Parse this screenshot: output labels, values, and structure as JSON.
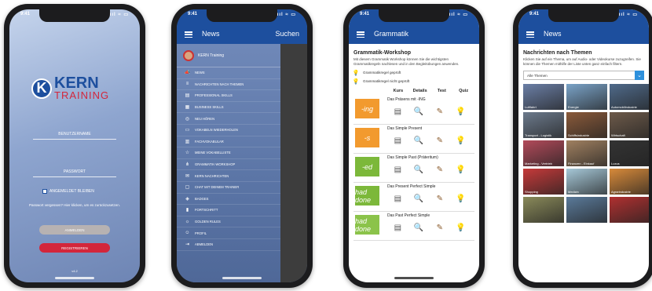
{
  "status_time": "9:41",
  "status_signal": "ııl ≈ ▭",
  "login": {
    "logo_letter": "K",
    "logo_kern": "KERN",
    "logo_training": "TRAINING",
    "username_placeholder": "BENUTZERNAME",
    "password_placeholder": "PASSWORT",
    "remember_label": "ANGEMELDET BLEIBEN",
    "forgot_text": "Passwort vergessen? Hier klicken, um es zurückzusetzen.",
    "login_button": "ANMELDEN",
    "register_button": "REGISTRIEREN",
    "footer": "v4.2"
  },
  "news_menu": {
    "title": "News",
    "search_label": "Suchen",
    "user_name": "KERN Training",
    "items": [
      {
        "label": "NEWS",
        "icon": "megaphone-icon",
        "glyph": "📣"
      },
      {
        "label": "NACHRICHTEN NACH THEMEN",
        "icon": "list-icon",
        "glyph": "≡"
      },
      {
        "label": "PROFESSIONAL SKILLS",
        "icon": "briefcase-icon",
        "glyph": "▤"
      },
      {
        "label": "BUSINESS SKILLS",
        "icon": "chart-icon",
        "glyph": "▦"
      },
      {
        "label": "NEU HÖREN",
        "icon": "headphones-icon",
        "glyph": "◎"
      },
      {
        "label": "VOKABELN WIEDERHOLEN",
        "icon": "cards-icon",
        "glyph": "▭"
      },
      {
        "label": "FACHVOKABULAR",
        "icon": "book-icon",
        "glyph": "▥"
      },
      {
        "label": "MEINE VOKABELLISTE",
        "icon": "star-list-icon",
        "glyph": "☆"
      },
      {
        "label": "GRAMMATIK-WORKSHOP",
        "icon": "network-icon",
        "glyph": "⋔"
      },
      {
        "label": "KERN NACHRICHTEN",
        "icon": "mail-icon",
        "glyph": "✉"
      },
      {
        "label": "CHAT MIT DEINEM TRAINER",
        "icon": "chat-icon",
        "glyph": "▢"
      },
      {
        "label": "BADGES",
        "icon": "badge-icon",
        "glyph": "◈"
      },
      {
        "label": "FORTSCHRITT",
        "icon": "progress-icon",
        "glyph": "▮"
      },
      {
        "label": "GOLDEN RULES",
        "icon": "bulb-icon",
        "glyph": "☼"
      },
      {
        "label": "PROFIL",
        "icon": "person-icon",
        "glyph": "☺"
      },
      {
        "label": "ABMELDEN",
        "icon": "logout-icon",
        "glyph": "⇥"
      }
    ]
  },
  "grammar": {
    "title": "Grammatik",
    "heading": "Grammatik-Workshop",
    "description": "Mit diesem Grammatik Workshop können Sie die wichtigsten Grammatikregeln nachlesen und in den Begleitübungen anwenden.",
    "legend_checked": "Grammatikregel geprüft",
    "legend_unchecked": "Grammatikregel nicht geprüft",
    "columns": [
      "Kurs",
      "Details",
      "Test",
      "Quiz"
    ],
    "lessons": [
      {
        "name": "Das Präsens mit -ING",
        "thumb": "-ing",
        "color": "#f29a2e"
      },
      {
        "name": "Das Simple Present",
        "thumb": "-s",
        "color": "#f29a2e"
      },
      {
        "name": "Das Simple Past (Präteritum)",
        "thumb": "-ed",
        "color": "#7cb83a"
      },
      {
        "name": "Das Present Perfect Simple",
        "thumb": "had done",
        "color": "#7cb83a"
      },
      {
        "name": "Das Past Perfect Simple",
        "thumb": "had done",
        "color": "#8bc34a"
      }
    ]
  },
  "news_topics": {
    "title": "News",
    "heading": "Nachrichten nach Themen",
    "description": "Klicken Sie auf ein Thema, um auf Audio- oder Videokurse zuzugreifen. Sie können die Themen mithilfe der Liste unten ganz einfach filtern.",
    "select_value": "Alle Themen",
    "tiles": [
      {
        "label": "Luftfahrt",
        "color": "#6b7fa6"
      },
      {
        "label": "Energie",
        "color": "#7aa3c8"
      },
      {
        "label": "Automobilindustrie",
        "color": "#4f6a8a"
      },
      {
        "label": "Transport - Logistik",
        "color": "#6c7a8c"
      },
      {
        "label": "Schiffsindustrie",
        "color": "#8a5a3a"
      },
      {
        "label": "Wirtschaft",
        "color": "#6d5a4a"
      },
      {
        "label": "Marketing - Vertrieb",
        "color": "#b24a5a"
      },
      {
        "label": "Finanzen - Einkauf",
        "color": "#a08060"
      },
      {
        "label": "Luxus",
        "color": "#333333"
      },
      {
        "label": "Shopping",
        "color": "#c63a3a"
      },
      {
        "label": "Medizin",
        "color": "#a6c8d8"
      },
      {
        "label": "Agrarindustrie",
        "color": "#d88a3a"
      },
      {
        "label": "",
        "color": "#8a8a5a"
      },
      {
        "label": "",
        "color": "#5a7a9a"
      },
      {
        "label": "",
        "color": "#b03030"
      }
    ]
  }
}
